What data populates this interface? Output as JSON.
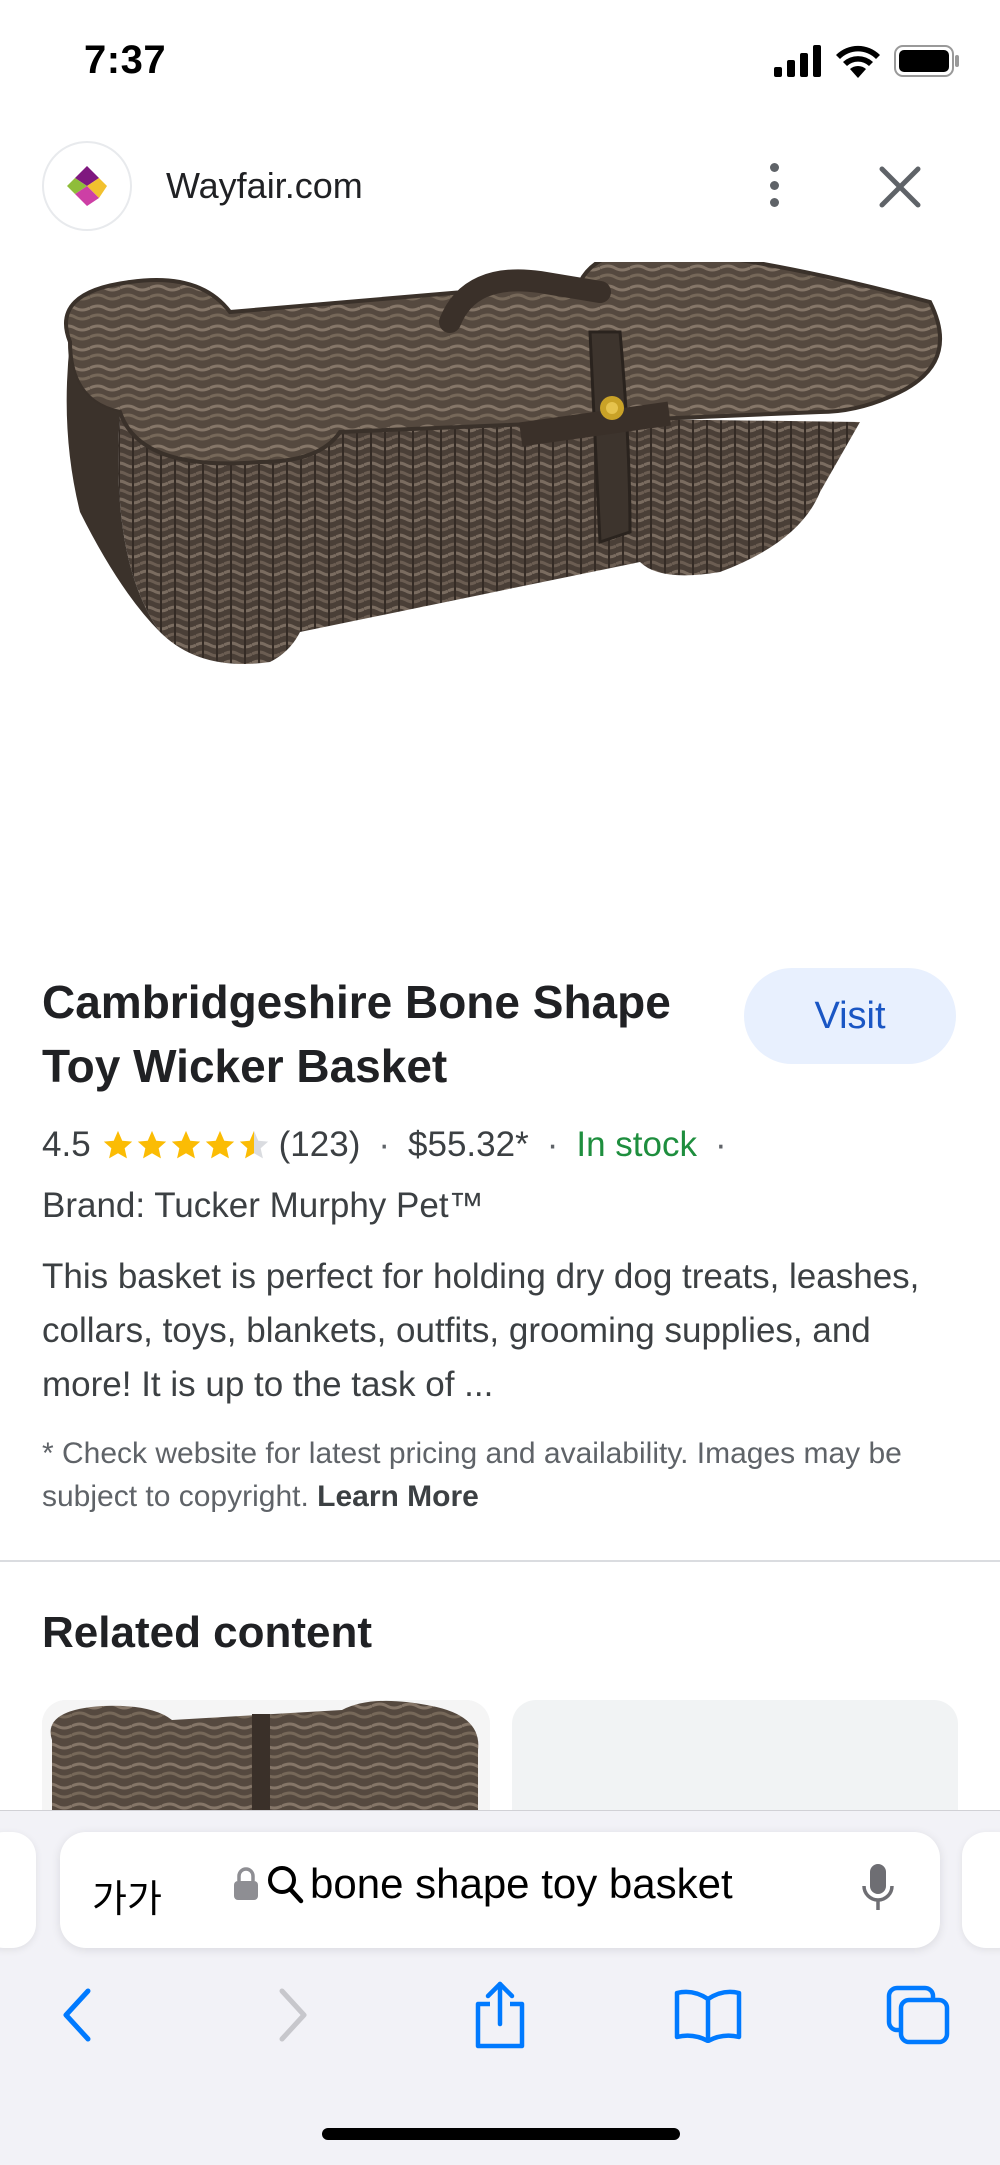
{
  "status_bar": {
    "time": "7:37"
  },
  "site": {
    "name": "Wayfair.com"
  },
  "product": {
    "title": "Cambridgeshire Bone Shape Toy Wicker Basket",
    "visit_label": "Visit",
    "rating": "4.5",
    "rating_value": 4.5,
    "reviews": "(123)",
    "price": "$55.32*",
    "stock": "In stock",
    "brand": "Brand: Tucker Murphy Pet™",
    "description": "This basket is perfect for holding dry dog treats, leashes, collars, toys, blankets, outfits, grooming supplies, and more! It is up to the task of ...",
    "disclaimer": "* Check website for latest pricing and availability. Images may be subject to copyright.",
    "learn_more": "Learn More"
  },
  "related": {
    "title": "Related content"
  },
  "browser": {
    "text_size_label": "가가",
    "url_query": "bone shape toy basket"
  },
  "colors": {
    "accent": "#1a56c4",
    "visit_bg": "#e8f0fe",
    "in_stock": "#1e8e3e",
    "star": "#fbbc04",
    "ios_blue": "#007aff"
  },
  "icons": [
    "signal-icon",
    "wifi-icon",
    "battery-icon",
    "wayfair-logo-icon",
    "more-vert-icon",
    "close-icon",
    "star-icon",
    "lock-icon",
    "search-icon",
    "mic-icon",
    "back-icon",
    "forward-icon",
    "share-icon",
    "bookmarks-icon",
    "tabs-icon"
  ]
}
